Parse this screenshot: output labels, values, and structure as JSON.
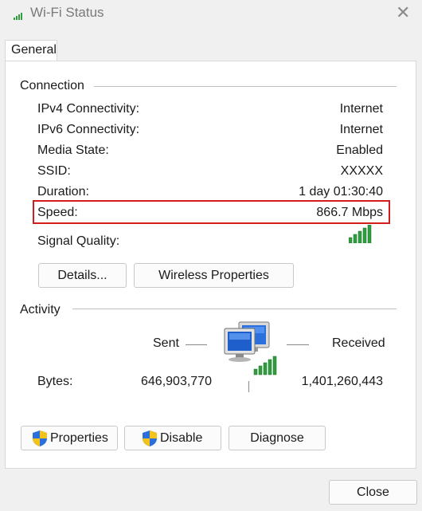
{
  "window": {
    "title": "Wi-Fi Status",
    "close_glyph": "✕"
  },
  "tabs": [
    {
      "label": "General"
    }
  ],
  "connection": {
    "label": "Connection",
    "rows": [
      {
        "label": "IPv4 Connectivity:",
        "value": "Internet"
      },
      {
        "label": "IPv6 Connectivity:",
        "value": "Internet"
      },
      {
        "label": "Media State:",
        "value": "Enabled"
      },
      {
        "label": "SSID:",
        "value": "XXXXX"
      },
      {
        "label": "Duration:",
        "value": "1 day 01:30:40"
      },
      {
        "label": "Speed:",
        "value": "866.7 Mbps"
      }
    ],
    "signal_label": "Signal Quality:",
    "signal_icon": "signal-bars-icon",
    "highlight_color": "#d21d1d"
  },
  "connection_buttons": {
    "details": "Details...",
    "wireless_properties": "Wireless Properties"
  },
  "activity": {
    "label": "Activity",
    "sent_label": "Sent",
    "received_label": "Received",
    "bytes_label": "Bytes:",
    "bytes_sent": "646,903,770",
    "bytes_received": "1,401,260,443",
    "network_icon": "network-computers-icon"
  },
  "activity_buttons": {
    "properties": "Properties",
    "disable": "Disable",
    "diagnose": "Diagnose"
  },
  "footer": {
    "close": "Close"
  },
  "colors": {
    "signal_green": "#2e9e3e",
    "monitor_blue": "#2a6fdb"
  }
}
